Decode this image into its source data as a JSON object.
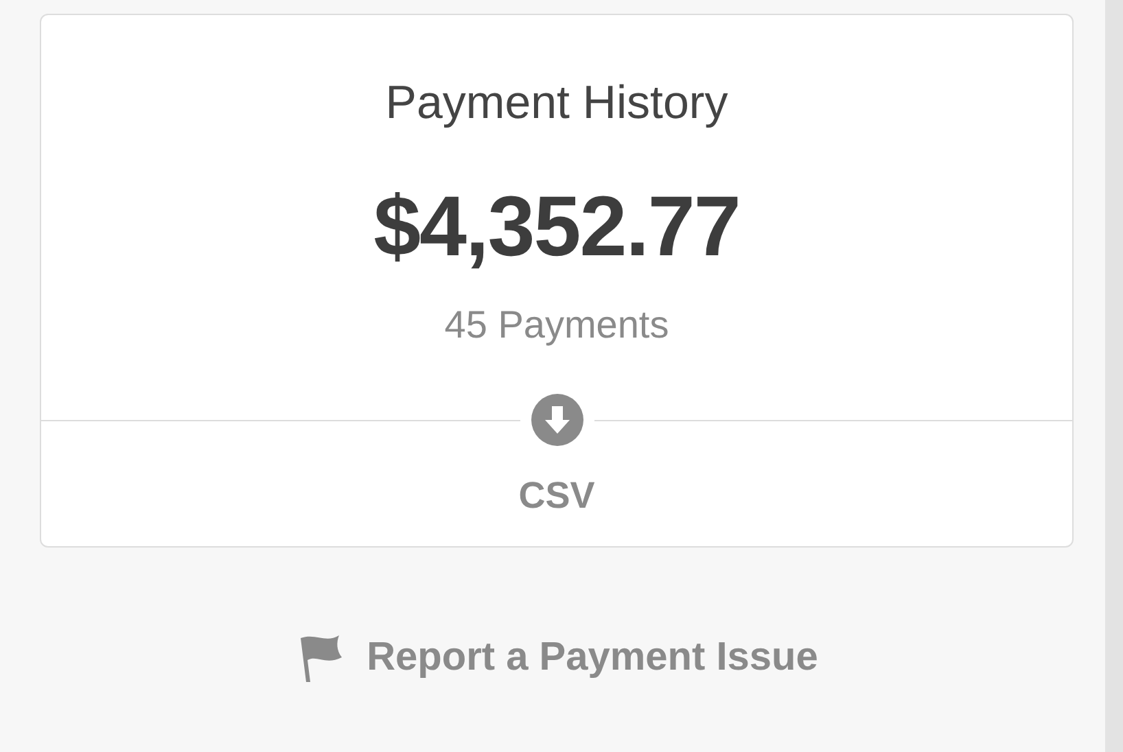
{
  "card": {
    "title": "Payment History",
    "amount": "$4,352.77",
    "count": "45 Payments",
    "download": {
      "label": "CSV"
    }
  },
  "report_link": {
    "label": "Report a Payment Issue"
  }
}
